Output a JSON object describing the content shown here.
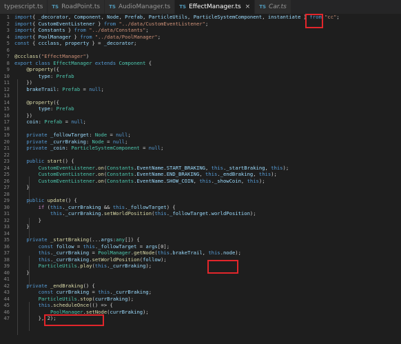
{
  "tabs": [
    {
      "label": "typescript.ts",
      "has_ts": false,
      "italic": false,
      "active": false
    },
    {
      "label": "RoadPoint.ts",
      "has_ts": true,
      "italic": false,
      "active": false
    },
    {
      "label": "AudioManager.ts",
      "has_ts": true,
      "italic": false,
      "active": false
    },
    {
      "label": "EffectManager.ts",
      "has_ts": true,
      "italic": false,
      "active": true,
      "close": "×"
    },
    {
      "label": "Car.ts",
      "has_ts": true,
      "italic": true,
      "active": false
    }
  ],
  "ts_badge": "TS",
  "lines": [
    {
      "n": "1",
      "tokens": [
        [
          "kw",
          "import"
        ],
        [
          "",
          "{ "
        ],
        [
          "var",
          "_decorator"
        ],
        [
          "",
          ", "
        ],
        [
          "var",
          "Component"
        ],
        [
          "",
          ", "
        ],
        [
          "var",
          "Node"
        ],
        [
          "",
          ", "
        ],
        [
          "var",
          "Prefab"
        ],
        [
          "",
          ", "
        ],
        [
          "var",
          "ParticleUtils"
        ],
        [
          "",
          ", "
        ],
        [
          "var",
          "ParticleSystemComponent"
        ],
        [
          "",
          ", "
        ],
        [
          "var",
          "instantiate"
        ],
        [
          "",
          " } "
        ],
        [
          "kw",
          "from"
        ],
        [
          "",
          " "
        ],
        [
          "str",
          "\"cc\""
        ],
        [
          "",
          ";"
        ]
      ]
    },
    {
      "n": "2",
      "tokens": [
        [
          "kw",
          "import"
        ],
        [
          "",
          "{ "
        ],
        [
          "var",
          "CustomEventListener"
        ],
        [
          "",
          " } "
        ],
        [
          "kw",
          "from"
        ],
        [
          "",
          " "
        ],
        [
          "str",
          "\"../data/CustomEventListener\""
        ],
        [
          "",
          ";"
        ]
      ]
    },
    {
      "n": "3",
      "tokens": [
        [
          "kw",
          "import"
        ],
        [
          "",
          "{ "
        ],
        [
          "var",
          "Constants"
        ],
        [
          "",
          " } "
        ],
        [
          "kw",
          "from"
        ],
        [
          "",
          " "
        ],
        [
          "str",
          "\"../data/Constants\""
        ],
        [
          "",
          ";"
        ]
      ]
    },
    {
      "n": "4",
      "tokens": [
        [
          "kw",
          "import"
        ],
        [
          "",
          "{ "
        ],
        [
          "var",
          "PoolManager"
        ],
        [
          "",
          " } "
        ],
        [
          "kw",
          "from"
        ],
        [
          "",
          " "
        ],
        [
          "str",
          "\"../data/PoolManager\""
        ],
        [
          "",
          ";"
        ]
      ]
    },
    {
      "n": "5",
      "tokens": [
        [
          "kw",
          "const"
        ],
        [
          "",
          " { "
        ],
        [
          "var",
          "ccclass"
        ],
        [
          "",
          ", "
        ],
        [
          "var",
          "property"
        ],
        [
          "",
          " } = "
        ],
        [
          "var",
          "_decorator"
        ],
        [
          "",
          ";"
        ]
      ]
    },
    {
      "n": "6",
      "tokens": []
    },
    {
      "n": "7",
      "tokens": [
        [
          "dec",
          "@ccclass"
        ],
        [
          "",
          "("
        ],
        [
          "str",
          "\"EffectManager\""
        ],
        [
          "",
          ")"
        ]
      ]
    },
    {
      "n": "8",
      "tokens": [
        [
          "kw",
          "export"
        ],
        [
          "",
          " "
        ],
        [
          "kw",
          "class"
        ],
        [
          "",
          " "
        ],
        [
          "ty",
          "EffectManager"
        ],
        [
          "",
          " "
        ],
        [
          "kw",
          "extends"
        ],
        [
          "",
          " "
        ],
        [
          "ty",
          "Component"
        ],
        [
          "",
          " {"
        ]
      ]
    },
    {
      "n": "9",
      "tokens": [
        [
          "",
          "    "
        ],
        [
          "dec",
          "@property"
        ],
        [
          "",
          "({"
        ]
      ]
    },
    {
      "n": "10",
      "tokens": [
        [
          "",
          "        "
        ],
        [
          "var",
          "type"
        ],
        [
          "",
          ": "
        ],
        [
          "ty",
          "Prefab"
        ]
      ]
    },
    {
      "n": "11",
      "tokens": [
        [
          "",
          "    })"
        ]
      ]
    },
    {
      "n": "12",
      "tokens": [
        [
          "",
          "    "
        ],
        [
          "var",
          "brakeTrail"
        ],
        [
          "",
          ": "
        ],
        [
          "ty",
          "Prefab"
        ],
        [
          "",
          " = "
        ],
        [
          "kw",
          "null"
        ],
        [
          "",
          ";"
        ]
      ]
    },
    {
      "n": "13",
      "tokens": []
    },
    {
      "n": "14",
      "tokens": [
        [
          "",
          "    "
        ],
        [
          "dec",
          "@property"
        ],
        [
          "",
          "({"
        ]
      ]
    },
    {
      "n": "15",
      "tokens": [
        [
          "",
          "        "
        ],
        [
          "var",
          "type"
        ],
        [
          "",
          ": "
        ],
        [
          "ty",
          "Prefab"
        ]
      ]
    },
    {
      "n": "16",
      "tokens": [
        [
          "",
          "    })"
        ]
      ]
    },
    {
      "n": "17",
      "tokens": [
        [
          "",
          "    "
        ],
        [
          "var",
          "coin"
        ],
        [
          "",
          ": "
        ],
        [
          "ty",
          "Prefab"
        ],
        [
          "",
          " = "
        ],
        [
          "kw",
          "null"
        ],
        [
          "",
          ";"
        ]
      ]
    },
    {
      "n": "18",
      "tokens": []
    },
    {
      "n": "19",
      "tokens": [
        [
          "",
          "    "
        ],
        [
          "kw",
          "private"
        ],
        [
          "",
          " "
        ],
        [
          "var",
          "_followTarget"
        ],
        [
          "",
          ": "
        ],
        [
          "ty",
          "Node"
        ],
        [
          "",
          " = "
        ],
        [
          "kw",
          "null"
        ],
        [
          "",
          ";"
        ]
      ]
    },
    {
      "n": "20",
      "tokens": [
        [
          "",
          "    "
        ],
        [
          "kw",
          "private"
        ],
        [
          "",
          " "
        ],
        [
          "var",
          "_currBraking"
        ],
        [
          "",
          ": "
        ],
        [
          "ty",
          "Node"
        ],
        [
          "",
          " = "
        ],
        [
          "kw",
          "null"
        ],
        [
          "",
          ";"
        ]
      ]
    },
    {
      "n": "21",
      "tokens": [
        [
          "",
          "    "
        ],
        [
          "kw",
          "private"
        ],
        [
          "",
          " "
        ],
        [
          "var",
          "_coin"
        ],
        [
          "",
          ": "
        ],
        [
          "ty",
          "ParticleSystemComponent"
        ],
        [
          "",
          " = "
        ],
        [
          "kw",
          "null"
        ],
        [
          "",
          ";"
        ]
      ]
    },
    {
      "n": "22",
      "tokens": []
    },
    {
      "n": "23",
      "tokens": [
        [
          "",
          "    "
        ],
        [
          "kw",
          "public"
        ],
        [
          "",
          " "
        ],
        [
          "fn",
          "start"
        ],
        [
          "",
          "() {"
        ]
      ]
    },
    {
      "n": "24",
      "tokens": [
        [
          "",
          "        "
        ],
        [
          "ty",
          "CustomEventListener"
        ],
        [
          "",
          "."
        ],
        [
          "fn",
          "on"
        ],
        [
          "",
          "("
        ],
        [
          "ty",
          "Constants"
        ],
        [
          "",
          "."
        ],
        [
          "var",
          "EventName"
        ],
        [
          "",
          "."
        ],
        [
          "var",
          "START_BRAKING"
        ],
        [
          "",
          ", "
        ],
        [
          "kw",
          "this"
        ],
        [
          "",
          "."
        ],
        [
          "var",
          "_startBraking"
        ],
        [
          "",
          ", "
        ],
        [
          "kw",
          "this"
        ],
        [
          "",
          ");"
        ]
      ]
    },
    {
      "n": "25",
      "tokens": [
        [
          "",
          "        "
        ],
        [
          "ty",
          "CustomEventListener"
        ],
        [
          "",
          "."
        ],
        [
          "fn",
          "on"
        ],
        [
          "",
          "("
        ],
        [
          "ty",
          "Constants"
        ],
        [
          "",
          "."
        ],
        [
          "var",
          "EventName"
        ],
        [
          "",
          "."
        ],
        [
          "var",
          "END_BRAKING"
        ],
        [
          "",
          ", "
        ],
        [
          "kw",
          "this"
        ],
        [
          "",
          "."
        ],
        [
          "var",
          "_endBraking"
        ],
        [
          "",
          ", "
        ],
        [
          "kw",
          "this"
        ],
        [
          "",
          ");"
        ]
      ]
    },
    {
      "n": "26",
      "tokens": [
        [
          "",
          "        "
        ],
        [
          "ty",
          "CustomEventListener"
        ],
        [
          "",
          "."
        ],
        [
          "fn",
          "on"
        ],
        [
          "",
          "("
        ],
        [
          "ty",
          "Constants"
        ],
        [
          "",
          "."
        ],
        [
          "var",
          "EventName"
        ],
        [
          "",
          "."
        ],
        [
          "var",
          "SHOW_COIN"
        ],
        [
          "",
          ", "
        ],
        [
          "kw",
          "this"
        ],
        [
          "",
          "."
        ],
        [
          "var",
          "_showCoin"
        ],
        [
          "",
          ", "
        ],
        [
          "kw",
          "this"
        ],
        [
          "",
          ");"
        ]
      ]
    },
    {
      "n": "27",
      "tokens": [
        [
          "",
          "    }"
        ]
      ]
    },
    {
      "n": "28",
      "tokens": []
    },
    {
      "n": "29",
      "tokens": [
        [
          "",
          "    "
        ],
        [
          "kw",
          "public"
        ],
        [
          "",
          " "
        ],
        [
          "fn",
          "update"
        ],
        [
          "",
          "() {"
        ]
      ]
    },
    {
      "n": "30",
      "tokens": [
        [
          "",
          "        "
        ],
        [
          "cf",
          "if"
        ],
        [
          "",
          " ("
        ],
        [
          "kw",
          "this"
        ],
        [
          "",
          "."
        ],
        [
          "var",
          "_currBraking"
        ],
        [
          "",
          " && "
        ],
        [
          "kw",
          "this"
        ],
        [
          "",
          "."
        ],
        [
          "var",
          "_followTarget"
        ],
        [
          "",
          ") {"
        ]
      ]
    },
    {
      "n": "31",
      "tokens": [
        [
          "",
          "            "
        ],
        [
          "kw",
          "this"
        ],
        [
          "",
          "."
        ],
        [
          "var",
          "_currBraking"
        ],
        [
          "",
          "."
        ],
        [
          "fn",
          "setWorldPosition"
        ],
        [
          "",
          "("
        ],
        [
          "kw",
          "this"
        ],
        [
          "",
          "."
        ],
        [
          "var",
          "_followTarget"
        ],
        [
          "",
          "."
        ],
        [
          "var",
          "worldPosition"
        ],
        [
          "",
          ");"
        ]
      ]
    },
    {
      "n": "32",
      "tokens": [
        [
          "",
          "        }"
        ]
      ]
    },
    {
      "n": "33",
      "tokens": [
        [
          "",
          "    }"
        ]
      ]
    },
    {
      "n": "34",
      "tokens": []
    },
    {
      "n": "35",
      "tokens": [
        [
          "",
          "    "
        ],
        [
          "kw",
          "private"
        ],
        [
          "",
          " "
        ],
        [
          "fn",
          "_startBraking"
        ],
        [
          "",
          "(..."
        ],
        [
          "var",
          "args"
        ],
        [
          "",
          ":"
        ],
        [
          "ty",
          "any"
        ],
        [
          "",
          "[]) {"
        ]
      ]
    },
    {
      "n": "36",
      "tokens": [
        [
          "",
          "        "
        ],
        [
          "kw",
          "const"
        ],
        [
          "",
          " "
        ],
        [
          "var",
          "follow"
        ],
        [
          "",
          " = "
        ],
        [
          "kw",
          "this"
        ],
        [
          "",
          "."
        ],
        [
          "var",
          "_followTarget"
        ],
        [
          "",
          " = "
        ],
        [
          "var",
          "args"
        ],
        [
          "",
          "[0];"
        ]
      ]
    },
    {
      "n": "37",
      "tokens": [
        [
          "",
          "        "
        ],
        [
          "kw",
          "this"
        ],
        [
          "",
          "."
        ],
        [
          "var",
          "_currBraking"
        ],
        [
          "",
          " = "
        ],
        [
          "ty",
          "PoolManager"
        ],
        [
          "",
          "."
        ],
        [
          "fn",
          "getNode"
        ],
        [
          "",
          "("
        ],
        [
          "kw",
          "this"
        ],
        [
          "",
          "."
        ],
        [
          "var",
          "brakeTrail"
        ],
        [
          "",
          ", "
        ],
        [
          "kw",
          "this"
        ],
        [
          "",
          "."
        ],
        [
          "var",
          "node"
        ],
        [
          "",
          ");"
        ]
      ]
    },
    {
      "n": "38",
      "tokens": [
        [
          "",
          "        "
        ],
        [
          "kw",
          "this"
        ],
        [
          "",
          "."
        ],
        [
          "var",
          "_currBraking"
        ],
        [
          "",
          "."
        ],
        [
          "fn",
          "setWorldPosition"
        ],
        [
          "",
          "("
        ],
        [
          "var",
          "follow"
        ],
        [
          "",
          ");"
        ]
      ]
    },
    {
      "n": "39",
      "tokens": [
        [
          "",
          "        "
        ],
        [
          "ty",
          "ParticleUtils"
        ],
        [
          "",
          "."
        ],
        [
          "fn",
          "play"
        ],
        [
          "",
          "("
        ],
        [
          "kw",
          "this"
        ],
        [
          "",
          "."
        ],
        [
          "var",
          "_currBraking"
        ],
        [
          "",
          ");"
        ]
      ]
    },
    {
      "n": "40",
      "tokens": [
        [
          "",
          "    }"
        ]
      ]
    },
    {
      "n": "41",
      "tokens": []
    },
    {
      "n": "42",
      "tokens": [
        [
          "",
          "    "
        ],
        [
          "kw",
          "private"
        ],
        [
          "",
          " "
        ],
        [
          "fn",
          "_endBraking"
        ],
        [
          "",
          "() {"
        ]
      ]
    },
    {
      "n": "43",
      "tokens": [
        [
          "",
          "        "
        ],
        [
          "kw",
          "const"
        ],
        [
          "",
          " "
        ],
        [
          "var",
          "currBraking"
        ],
        [
          "",
          " = "
        ],
        [
          "kw",
          "this"
        ],
        [
          "",
          "."
        ],
        [
          "var",
          "_currBraking"
        ],
        [
          "",
          ";"
        ]
      ]
    },
    {
      "n": "44",
      "tokens": [
        [
          "",
          "        "
        ],
        [
          "ty",
          "ParticleUtils"
        ],
        [
          "",
          "."
        ],
        [
          "fn",
          "stop"
        ],
        [
          "",
          "("
        ],
        [
          "var",
          "currBraking"
        ],
        [
          "",
          ");"
        ]
      ]
    },
    {
      "n": "45",
      "tokens": [
        [
          "",
          "        "
        ],
        [
          "kw",
          "this"
        ],
        [
          "",
          "."
        ],
        [
          "fn",
          "scheduleOnce"
        ],
        [
          "",
          "(() => {"
        ]
      ]
    },
    {
      "n": "46",
      "tokens": [
        [
          "",
          "            "
        ],
        [
          "ty",
          "PoolManager"
        ],
        [
          "",
          "."
        ],
        [
          "fn",
          "setNode"
        ],
        [
          "",
          "("
        ],
        [
          "var",
          "currBraking"
        ],
        [
          "",
          ");"
        ]
      ]
    },
    {
      "n": "47",
      "tokens": [
        [
          "",
          "        }, 2);"
        ]
      ]
    }
  ]
}
